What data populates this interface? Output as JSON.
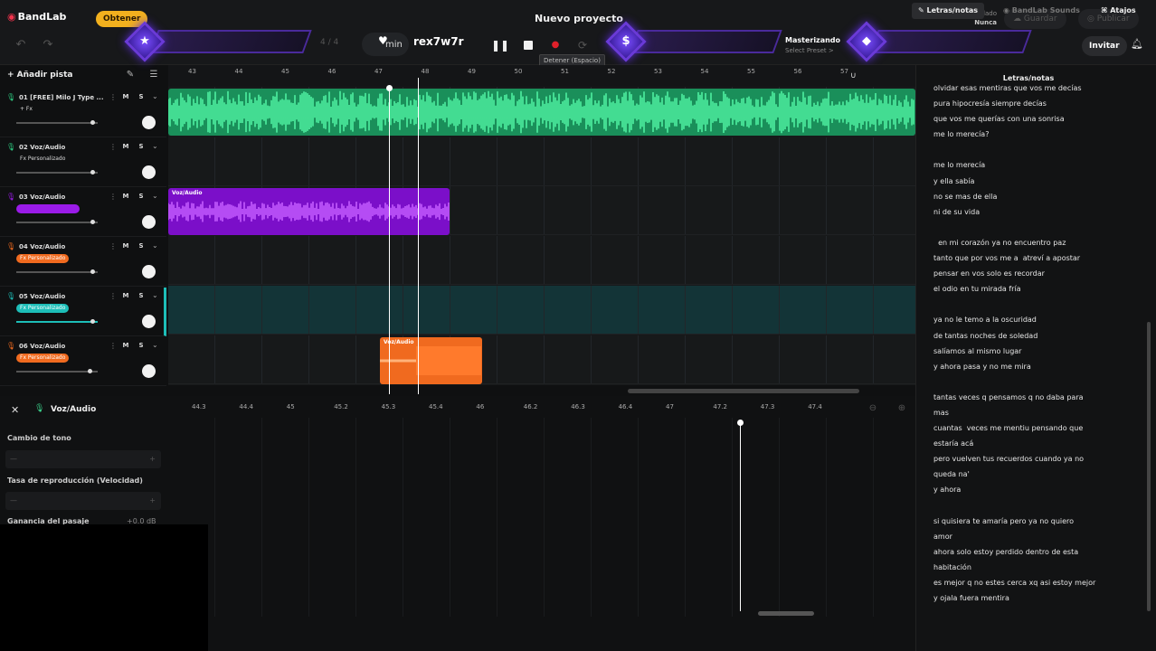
{
  "app": {
    "brand": "BandLab",
    "get_label": "Obtener",
    "project_title": "Nuevo proyecto",
    "time_sig": "4 / 4",
    "tempo_unit": "min",
    "track_title": "rex7w7r",
    "tooltip": "Detener (Espacio)",
    "mastering_label": "Masterizando",
    "mastering_sub": "Select Preset >",
    "last_saved_label": "Último guardado",
    "last_saved_value": "Nunca",
    "save_label": "Guardar",
    "publish_label": "Publicar",
    "invite_label": "Invitar"
  },
  "toolbar": {
    "add_track": "+ Añadir pista",
    "promo_1_icon": "★",
    "promo_2_icon": "$",
    "promo_3_icon": "◆"
  },
  "tracks": [
    {
      "name": "01 [FREE] Milo J Type ...",
      "fx": "+ Fx",
      "color": "#2ecf83",
      "slider": 0.95
    },
    {
      "name": "02 Voz/Audio",
      "fx": "Fx Personalizado",
      "color": "#2ecf83",
      "slider": 0.95
    },
    {
      "name": "03 Voz/Audio",
      "fx": "",
      "color": "#9a1be8",
      "slider": 0.95
    },
    {
      "name": "04 Voz/Audio",
      "fx": "Fx Personalizado",
      "color": "#f06a1f",
      "slider": 0.95
    },
    {
      "name": "05 Voz/Audio",
      "fx": "Fx Personalizado",
      "color": "#1dbeb8",
      "slider": 0.95
    },
    {
      "name": "06 Voz/Audio",
      "fx": "Fx Personalizado",
      "color": "#f06a1f",
      "slider": 0.92
    }
  ],
  "ruler_ticks": [
    "43",
    "44",
    "45",
    "46",
    "47",
    "48",
    "49",
    "50",
    "51",
    "52",
    "53",
    "54",
    "55",
    "56",
    "57"
  ],
  "bottom_ruler_ticks": [
    "44.3",
    "44.4",
    "45",
    "45.2",
    "45.3",
    "45.4",
    "46",
    "46.2",
    "46.3",
    "46.4",
    "47",
    "47.2",
    "47.3",
    "47.4"
  ],
  "clips": {
    "purple_label": "Voz/Audio",
    "orange_label": "Voz/Audio"
  },
  "editor": {
    "title": "Voz/Audio",
    "pitch_label": "Cambio de tono",
    "rate_label": "Tasa de reproducción (Velocidad)",
    "gain_label": "Ganancia del pasaje",
    "gain_value": "+0.0 dB",
    "field_placeholder": "—"
  },
  "lyrics": {
    "title": "Letras/notas",
    "text": "olvidar esas mentiras que vos me decías\npura hipocresía siempre decías\nque vos me querías con una sonrisa\nme lo merecía?\n\nme lo merecía\ny ella sabía\nno se mas de ella\nni de su vida\n\n  en mi corazón ya no encuentro paz\ntanto que por vos me a  atreví a apostar\npensar en vos solo es recordar\nel odio en tu mirada fría\n\nya no le temo a la oscuridad\nde tantas noches de soledad\nsalíamos al mismo lugar\ny ahora pasa y no me mira\n\ntantas veces q pensamos q no daba para\nmas\ncuantas  veces me mentiu pensando que\nestaría acá\npero vuelven tus recuerdos cuando ya no\nqueda na'\ny ahora\n\nsi quisiera te amaría pero ya no quiero\namor\nahora solo estoy perdido dentro de esta\nhabitación\nes mejor q no estes cerca xq asi estoy mejor\ny ojala fuera mentira"
  },
  "bottom_tabs": {
    "lyrics": "Letras/notas",
    "sounds": "BandLab Sounds",
    "shortcuts": "Atajos"
  }
}
